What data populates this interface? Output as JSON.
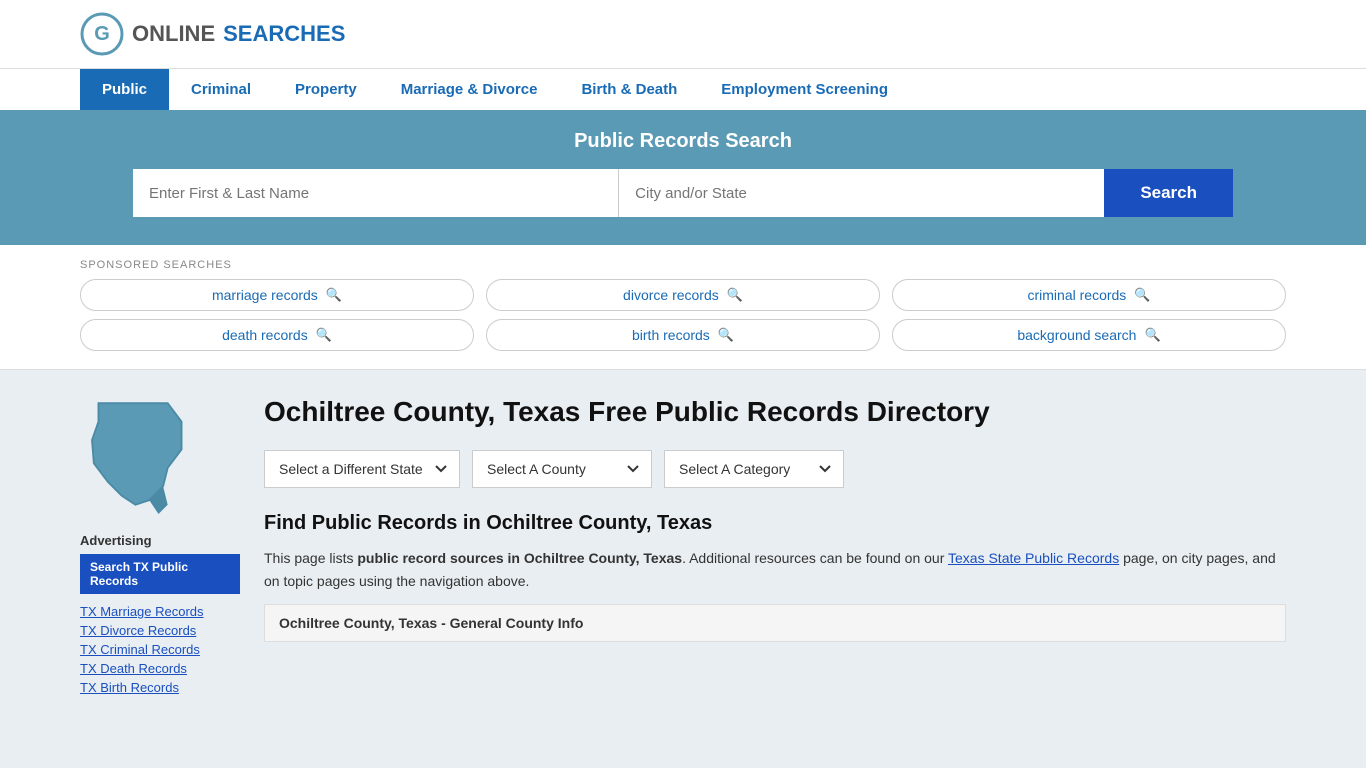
{
  "logo": {
    "text_online": "ONLINE",
    "text_searches": "SEARCHES"
  },
  "nav": {
    "items": [
      {
        "label": "Public",
        "active": true
      },
      {
        "label": "Criminal",
        "active": false
      },
      {
        "label": "Property",
        "active": false
      },
      {
        "label": "Marriage & Divorce",
        "active": false
      },
      {
        "label": "Birth & Death",
        "active": false
      },
      {
        "label": "Employment Screening",
        "active": false
      }
    ]
  },
  "search_banner": {
    "title": "Public Records Search",
    "name_placeholder": "Enter First & Last Name",
    "location_placeholder": "City and/or State",
    "search_btn_label": "Search"
  },
  "sponsored": {
    "label": "SPONSORED SEARCHES",
    "tags": [
      {
        "label": "marriage records"
      },
      {
        "label": "divorce records"
      },
      {
        "label": "criminal records"
      },
      {
        "label": "death records"
      },
      {
        "label": "birth records"
      },
      {
        "label": "background search"
      }
    ]
  },
  "sidebar": {
    "advertising_label": "Advertising",
    "ad_btn_label": "Search TX Public Records",
    "links": [
      "TX Marriage Records",
      "TX Divorce Records",
      "TX Criminal Records",
      "TX Death Records",
      "TX Birth Records"
    ]
  },
  "content": {
    "page_title": "Ochiltree County, Texas Free Public Records Directory",
    "dropdowns": {
      "state_placeholder": "Select a Different State",
      "county_placeholder": "Select A County",
      "category_placeholder": "Select A Category"
    },
    "find_records_title": "Find Public Records in Ochiltree County, Texas",
    "description": "This page lists ",
    "description_bold": "public record sources in Ochiltree County, Texas",
    "description_mid": ". Additional resources can be found on our ",
    "description_link": "Texas State Public Records",
    "description_end": " page, on city pages, and on topic pages using the navigation above.",
    "county_info_header": "Ochiltree County, Texas - General County Info"
  }
}
